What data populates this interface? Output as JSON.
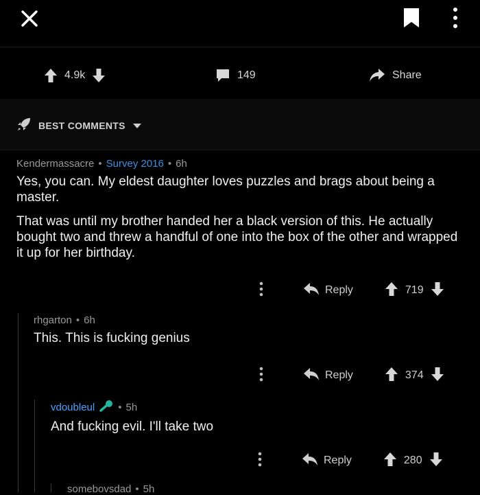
{
  "post_actions": {
    "score": "4.9k",
    "comments": "149",
    "share": "Share"
  },
  "sort": {
    "label": "BEST COMMENTS"
  },
  "comments": [
    {
      "author": "Kendermassacre",
      "flair": "Survey 2016",
      "age": "6h",
      "paragraphs": [
        "Yes, you can. My eldest daughter loves puzzles and brags about being a master.",
        "That was until my brother handed her a black version of this. He actually bought two and threw a handful of one into the box of the other and wrapped it up for her birthday."
      ],
      "reply": "Reply",
      "score": "719"
    },
    {
      "author": "rhgarton",
      "age": "6h",
      "text": "This. This is fucking genius",
      "reply": "Reply",
      "score": "374"
    },
    {
      "author": "vdoubleul",
      "age": "5h",
      "text": "And fucking evil. I'll take two",
      "reply": "Reply",
      "score": "280"
    },
    {
      "author": "somebovsdad",
      "age": "5h"
    }
  ],
  "colors": {
    "background": "#000000",
    "flair_blue": "#3d8fe0",
    "user_badge_teal": "#26b5a0"
  }
}
